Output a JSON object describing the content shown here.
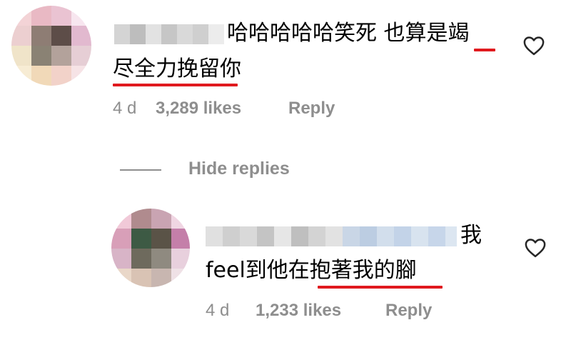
{
  "comment": {
    "text_line1": "哈哈哈哈哈笑死 也算是竭",
    "text_line2": "尽全力挽留你",
    "time": "4 d",
    "likes": "3,289 likes",
    "reply": "Reply"
  },
  "replies_toggle": {
    "label": "Hide replies"
  },
  "reply": {
    "text_line1": "我",
    "text_line2": "feel到他在抱著我的腳",
    "time": "4 d",
    "likes": "1,233 likes",
    "reply": "Reply"
  },
  "colors": {
    "underline": "#e0191e",
    "meta": "#8e8e8e",
    "story_ring": "#f5a623"
  },
  "icons": {
    "like": "heart-outline-icon"
  }
}
